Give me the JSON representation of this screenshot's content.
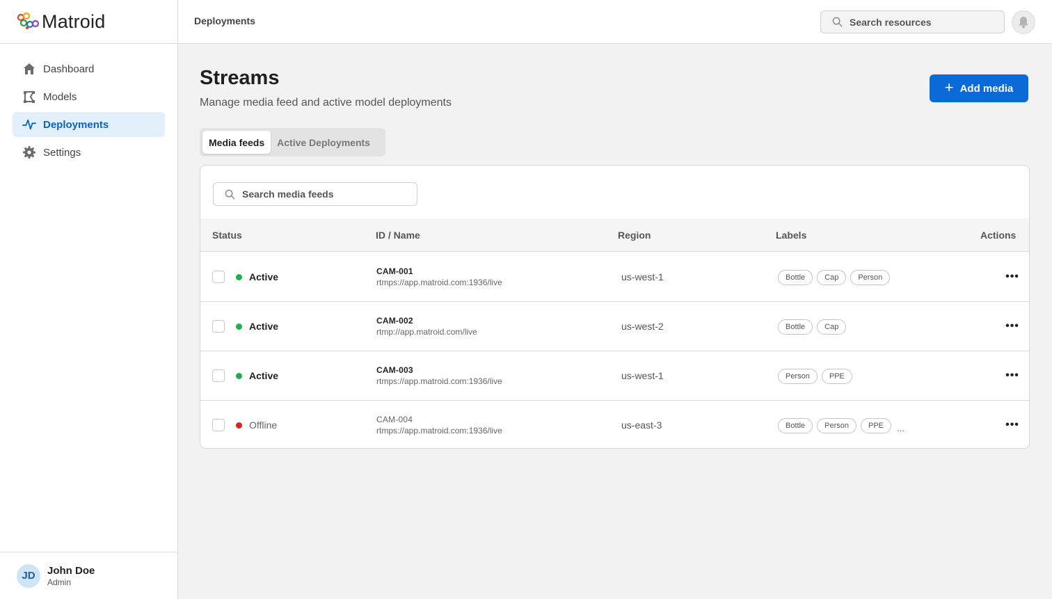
{
  "brand": {
    "name": "Matroid"
  },
  "sidebar": {
    "items": [
      {
        "label": "Dashboard",
        "icon": "home-icon"
      },
      {
        "label": "Models",
        "icon": "models-icon"
      },
      {
        "label": "Deployments",
        "icon": "activity-icon",
        "active": true
      },
      {
        "label": "Settings",
        "icon": "gear-icon"
      }
    ],
    "user": {
      "initials": "JD",
      "name": "John Doe",
      "role": "Admin"
    }
  },
  "header": {
    "breadcrumb": "Deployments",
    "search_placeholder": "Search resources"
  },
  "main": {
    "title": "Streams",
    "subtitle": "Manage media feed and active model deployments",
    "add_button": "Add media",
    "tabs": [
      {
        "label": "Media feeds",
        "active": true
      },
      {
        "label": "Active Deployments",
        "active": false
      }
    ],
    "search_placeholder": "Search media feeds",
    "columns": {
      "status": "Status",
      "id_name": "ID / Name",
      "region": "Region",
      "labels": "Labels",
      "actions": "Actions"
    },
    "rows": [
      {
        "status": "Active",
        "status_color": "#1db14a",
        "id": "CAM-001",
        "url": "rtmps://app.matroid.com:1936/live",
        "region": "us-west-1",
        "labels": [
          "Bottle",
          "Cap",
          "Person"
        ],
        "more": ""
      },
      {
        "status": "Active",
        "status_color": "#1db14a",
        "id": "CAM-002",
        "url": "rtmp://app.matroid.com/live",
        "region": "us-west-2",
        "labels": [
          "Bottle",
          "Cap"
        ],
        "more": ""
      },
      {
        "status": "Active",
        "status_color": "#1db14a",
        "id": "CAM-003",
        "url": "rtmps://app.matroid.com:1936/live",
        "region": "us-west-1",
        "labels": [
          "Person",
          "PPE"
        ],
        "more": ""
      },
      {
        "status": "Offline",
        "status_color": "#e0211d",
        "id": "CAM-004",
        "url": "rtmps://app.matroid.com:1936/live",
        "region": "us-east-3",
        "labels": [
          "Bottle",
          "Person",
          "PPE"
        ],
        "more": "..."
      }
    ]
  },
  "colors": {
    "accent": "#0a6ad8",
    "active_nav_bg": "#e3effb",
    "active_nav_text": "#0b63c4",
    "status_active": "#1db14a",
    "status_offline": "#e0211d"
  }
}
